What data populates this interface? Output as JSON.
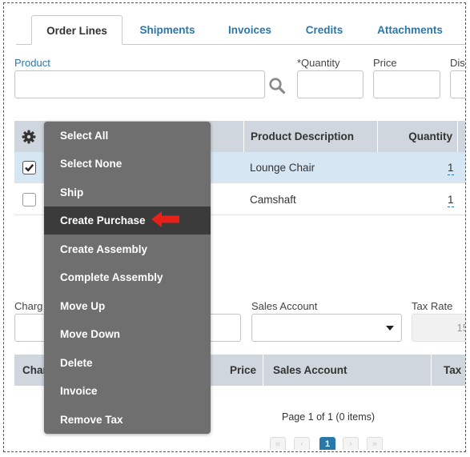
{
  "tabs": [
    {
      "label": "Order Lines",
      "active": true
    },
    {
      "label": "Shipments",
      "active": false
    },
    {
      "label": "Invoices",
      "active": false
    },
    {
      "label": "Credits",
      "active": false
    },
    {
      "label": "Attachments",
      "active": false
    }
  ],
  "form": {
    "product_label": "Product",
    "quantity_label": "*Quantity",
    "price_label": "Price",
    "discount_label_partial": "Dis"
  },
  "lines_table": {
    "columns": {
      "product_description": "Product Description",
      "quantity": "Quantity"
    },
    "rows": [
      {
        "checked": true,
        "description": "Lounge Chair",
        "quantity": "1"
      },
      {
        "checked": false,
        "description": "Camshaft",
        "quantity": "1"
      }
    ]
  },
  "context_menu": {
    "items": [
      "Select All",
      "Select None",
      "Ship",
      "Create Purchase",
      "Create Assembly",
      "Complete Assembly",
      "Move Up",
      "Move Down",
      "Delete",
      "Invoice",
      "Remove Tax"
    ],
    "highlighted": "Create Purchase"
  },
  "charges": {
    "charge_label_partial": "Charg",
    "sales_account_label": "Sales Account",
    "tax_rate_label": "Tax Rate",
    "tax_rate_value_partial": "15"
  },
  "charges_table": {
    "columns": {
      "charge_partial": "Char",
      "price": "Price",
      "sales_account": "Sales Account",
      "tax_partial": "Tax"
    }
  },
  "pager": {
    "text": "Page 1 of 1 (0 items)",
    "current_page": "1",
    "first": "«",
    "prev": "‹",
    "next": "›",
    "last": "»"
  },
  "colors": {
    "link_blue": "#2a78a8",
    "header_gray": "#cfd6dd",
    "menu_bg": "#6f6f6f",
    "menu_highlight": "#3b3b3b",
    "arrow_red": "#e8201a"
  }
}
